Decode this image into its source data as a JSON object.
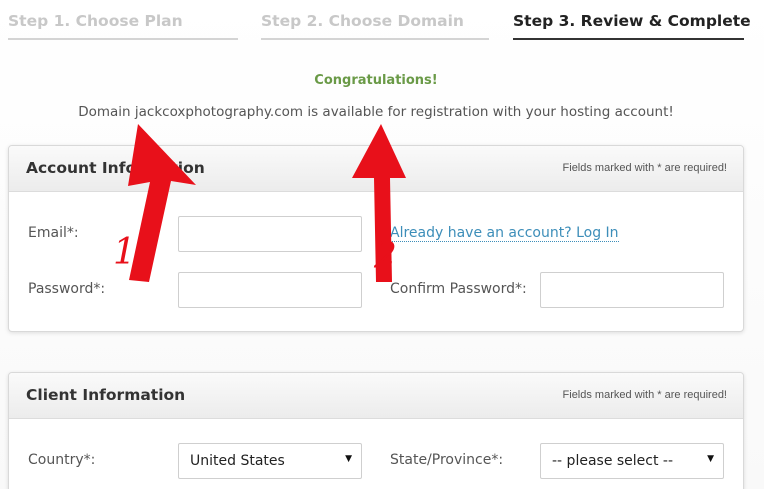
{
  "steps": [
    {
      "label": "Step 1. Choose Plan"
    },
    {
      "label": "Step 2. Choose Domain"
    },
    {
      "label": "Step 3. Review & Complete"
    }
  ],
  "message": {
    "title": "Congratulations!",
    "availability": "Domain jackcoxphotography.com is available for registration with your hosting account!"
  },
  "account": {
    "title": "Account Information",
    "required_note": "Fields marked with * are required!",
    "email_label": "Email*:",
    "email_value": "",
    "login_link": "Already have an account? Log In",
    "password_label": "Password*:",
    "password_value": "",
    "confirm_label": "Confirm Password*:",
    "confirm_value": ""
  },
  "client": {
    "title": "Client Information",
    "required_note": "Fields marked with * are required!",
    "country_label": "Country*:",
    "country_value": "United States",
    "state_label": "State/Province*:",
    "state_value": "-- please select --"
  },
  "annotations": [
    {
      "label": "1"
    },
    {
      "label": "2"
    }
  ],
  "colors": {
    "congrats": "#6a9a47",
    "link": "#3d8eb9",
    "annotation": "#e8101a"
  }
}
